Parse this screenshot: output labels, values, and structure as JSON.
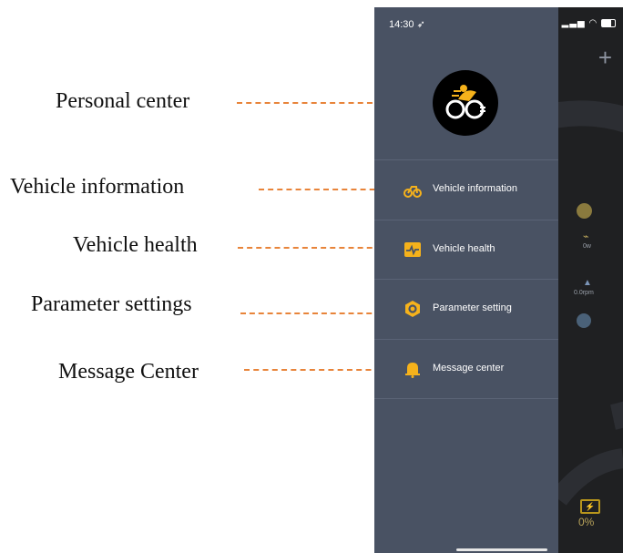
{
  "annotations": [
    {
      "label": "Personal center"
    },
    {
      "label": "Vehicle information"
    },
    {
      "label": "Vehicle health"
    },
    {
      "label": "Parameter settings"
    },
    {
      "label": "Message Center"
    }
  ],
  "status_bar": {
    "time": "14:30"
  },
  "menu": [
    {
      "label": "Vehicle information",
      "icon": "bike-icon"
    },
    {
      "label": "Vehicle health",
      "icon": "heartbeat-icon"
    },
    {
      "label": "Parameter setting",
      "icon": "hex-nut-icon"
    },
    {
      "label": "Message center",
      "icon": "bell-icon"
    }
  ],
  "background_app": {
    "power_value": "0w",
    "rpm_value": "0.0rpm",
    "battery_value": "0%"
  },
  "colors": {
    "accent": "#f6b21b",
    "dashed_line": "#e8843a",
    "drawer": "#495263"
  }
}
